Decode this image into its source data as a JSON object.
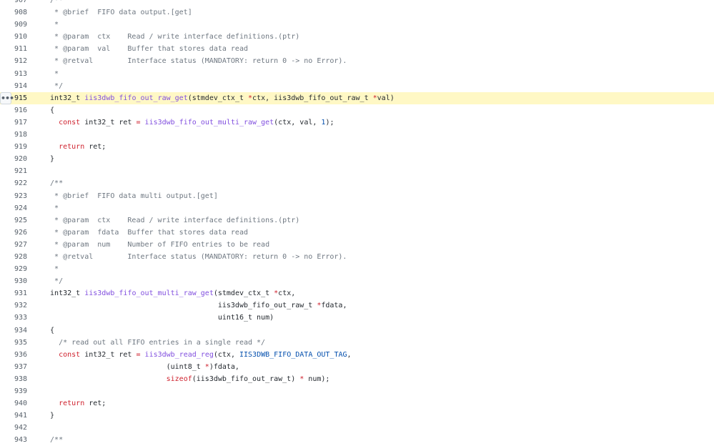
{
  "file_viewer": {
    "line_menu_icon": "kebab-horizontal-icon",
    "highlighted_line": 915,
    "colors": {
      "highlight": "#fff8c5",
      "comment": "#6e7781",
      "keyword": "#cf222e",
      "function": "#8250df",
      "constant": "#0550ae",
      "text": "#24292f",
      "line_number": "#57606a"
    },
    "lines": [
      {
        "n": "907",
        "segs": [
          {
            "t": "  /**",
            "c": "c"
          }
        ]
      },
      {
        "n": "908",
        "segs": [
          {
            "t": "   * @brief  FIFO data output.[get]",
            "c": "c"
          }
        ]
      },
      {
        "n": "909",
        "segs": [
          {
            "t": "   *",
            "c": "c"
          }
        ]
      },
      {
        "n": "910",
        "segs": [
          {
            "t": "   * @param  ctx    Read / write interface definitions.(ptr)",
            "c": "c"
          }
        ]
      },
      {
        "n": "911",
        "segs": [
          {
            "t": "   * @param  val    Buffer that stores data read",
            "c": "c"
          }
        ]
      },
      {
        "n": "912",
        "segs": [
          {
            "t": "   * @retval        Interface status (MANDATORY: return 0 -> no Error).",
            "c": "c"
          }
        ]
      },
      {
        "n": "913",
        "segs": [
          {
            "t": "   *",
            "c": "c"
          }
        ]
      },
      {
        "n": "914",
        "segs": [
          {
            "t": "   */",
            "c": "c"
          }
        ]
      },
      {
        "n": "915",
        "segs": [
          {
            "t": "  int32_t ",
            "c": "x"
          },
          {
            "t": "iis3dwb_fifo_out_raw_get",
            "c": "f"
          },
          {
            "t": "(stmdev_ctx_t ",
            "c": "x"
          },
          {
            "t": "*",
            "c": "k"
          },
          {
            "t": "ctx, iis3dwb_fifo_out_raw_t ",
            "c": "x"
          },
          {
            "t": "*",
            "c": "k"
          },
          {
            "t": "val)",
            "c": "x"
          }
        ]
      },
      {
        "n": "916",
        "segs": [
          {
            "t": "  {",
            "c": "x"
          }
        ]
      },
      {
        "n": "917",
        "segs": [
          {
            "t": "    ",
            "c": "x"
          },
          {
            "t": "const",
            "c": "k"
          },
          {
            "t": " int32_t ret ",
            "c": "x"
          },
          {
            "t": "=",
            "c": "k"
          },
          {
            "t": " ",
            "c": "x"
          },
          {
            "t": "iis3dwb_fifo_out_multi_raw_get",
            "c": "f"
          },
          {
            "t": "(ctx, val, ",
            "c": "x"
          },
          {
            "t": "1",
            "c": "e"
          },
          {
            "t": ");",
            "c": "x"
          }
        ]
      },
      {
        "n": "918",
        "segs": []
      },
      {
        "n": "919",
        "segs": [
          {
            "t": "    ",
            "c": "x"
          },
          {
            "t": "return",
            "c": "k"
          },
          {
            "t": " ret;",
            "c": "x"
          }
        ]
      },
      {
        "n": "920",
        "segs": [
          {
            "t": "  }",
            "c": "x"
          }
        ]
      },
      {
        "n": "921",
        "segs": []
      },
      {
        "n": "922",
        "segs": [
          {
            "t": "  /**",
            "c": "c"
          }
        ]
      },
      {
        "n": "923",
        "segs": [
          {
            "t": "   * @brief  FIFO data multi output.[get]",
            "c": "c"
          }
        ]
      },
      {
        "n": "924",
        "segs": [
          {
            "t": "   *",
            "c": "c"
          }
        ]
      },
      {
        "n": "925",
        "segs": [
          {
            "t": "   * @param  ctx    Read / write interface definitions.(ptr)",
            "c": "c"
          }
        ]
      },
      {
        "n": "926",
        "segs": [
          {
            "t": "   * @param  fdata  Buffer that stores data read",
            "c": "c"
          }
        ]
      },
      {
        "n": "927",
        "segs": [
          {
            "t": "   * @param  num    Number of FIFO entries to be read",
            "c": "c"
          }
        ]
      },
      {
        "n": "928",
        "segs": [
          {
            "t": "   * @retval        Interface status (MANDATORY: return 0 -> no Error).",
            "c": "c"
          }
        ]
      },
      {
        "n": "929",
        "segs": [
          {
            "t": "   *",
            "c": "c"
          }
        ]
      },
      {
        "n": "930",
        "segs": [
          {
            "t": "   */",
            "c": "c"
          }
        ]
      },
      {
        "n": "931",
        "segs": [
          {
            "t": "  int32_t ",
            "c": "x"
          },
          {
            "t": "iis3dwb_fifo_out_multi_raw_get",
            "c": "f"
          },
          {
            "t": "(stmdev_ctx_t ",
            "c": "x"
          },
          {
            "t": "*",
            "c": "k"
          },
          {
            "t": "ctx,",
            "c": "x"
          }
        ]
      },
      {
        "n": "932",
        "segs": [
          {
            "t": "                                         iis3dwb_fifo_out_raw_t ",
            "c": "x"
          },
          {
            "t": "*",
            "c": "k"
          },
          {
            "t": "fdata,",
            "c": "x"
          }
        ]
      },
      {
        "n": "933",
        "segs": [
          {
            "t": "                                         uint16_t num)",
            "c": "x"
          }
        ]
      },
      {
        "n": "934",
        "segs": [
          {
            "t": "  {",
            "c": "x"
          }
        ]
      },
      {
        "n": "935",
        "segs": [
          {
            "t": "    ",
            "c": "x"
          },
          {
            "t": "/* read out all FIFO entries in a single read */",
            "c": "c"
          }
        ]
      },
      {
        "n": "936",
        "segs": [
          {
            "t": "    ",
            "c": "x"
          },
          {
            "t": "const",
            "c": "k"
          },
          {
            "t": " int32_t ret ",
            "c": "x"
          },
          {
            "t": "=",
            "c": "k"
          },
          {
            "t": " ",
            "c": "x"
          },
          {
            "t": "iis3dwb_read_reg",
            "c": "f"
          },
          {
            "t": "(ctx, ",
            "c": "x"
          },
          {
            "t": "IIS3DWB_FIFO_DATA_OUT_TAG",
            "c": "e"
          },
          {
            "t": ",",
            "c": "x"
          }
        ]
      },
      {
        "n": "937",
        "segs": [
          {
            "t": "                             (uint8_t ",
            "c": "x"
          },
          {
            "t": "*",
            "c": "k"
          },
          {
            "t": ")fdata,",
            "c": "x"
          }
        ]
      },
      {
        "n": "938",
        "segs": [
          {
            "t": "                             ",
            "c": "x"
          },
          {
            "t": "sizeof",
            "c": "k"
          },
          {
            "t": "(iis3dwb_fifo_out_raw_t) ",
            "c": "x"
          },
          {
            "t": "*",
            "c": "k"
          },
          {
            "t": " num);",
            "c": "x"
          }
        ]
      },
      {
        "n": "939",
        "segs": []
      },
      {
        "n": "940",
        "segs": [
          {
            "t": "    ",
            "c": "x"
          },
          {
            "t": "return",
            "c": "k"
          },
          {
            "t": " ret;",
            "c": "x"
          }
        ]
      },
      {
        "n": "941",
        "segs": [
          {
            "t": "  }",
            "c": "x"
          }
        ]
      },
      {
        "n": "942",
        "segs": []
      },
      {
        "n": "943",
        "segs": [
          {
            "t": "  /**",
            "c": "c"
          }
        ]
      }
    ]
  }
}
